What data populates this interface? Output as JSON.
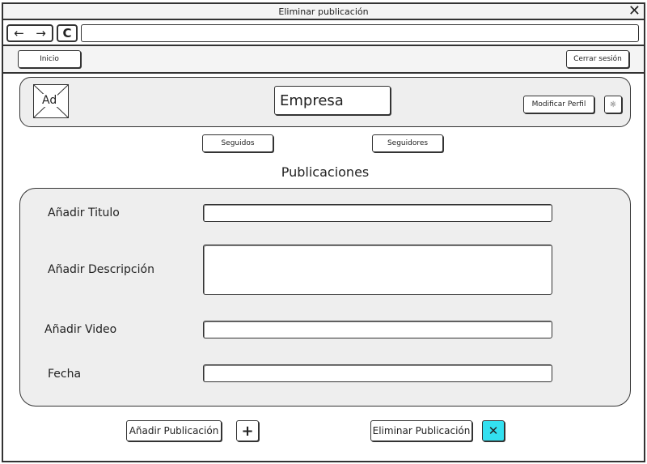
{
  "window": {
    "title": "Eliminar publicación",
    "close_icon": "close-icon"
  },
  "browser": {
    "back_glyph": "←",
    "forward_glyph": "→",
    "reload_glyph": "C",
    "url": ""
  },
  "menubar": {
    "home_label": "Inicio",
    "logout_label": "Cerrar sesión"
  },
  "profile": {
    "ad_label": "Ad",
    "name": "Empresa",
    "edit_profile_label": "Modificar Perfil",
    "settings_glyph": "☼"
  },
  "social": {
    "following_label": "Seguidos",
    "followers_label": "Seguidores"
  },
  "publications": {
    "heading": "Publicaciones",
    "form": {
      "title_label": "Añadir Titulo",
      "title_value": "",
      "description_label": "Añadir Descripción",
      "description_value": "",
      "video_label": "Añadir Video",
      "video_value": "",
      "date_label": "Fecha",
      "date_value": ""
    }
  },
  "actions": {
    "add_label": "Añadir Publicación",
    "add_glyph": "+",
    "delete_label": "Eliminar Publicación",
    "delete_glyph": "✕",
    "delete_color": "#33e0f0"
  }
}
